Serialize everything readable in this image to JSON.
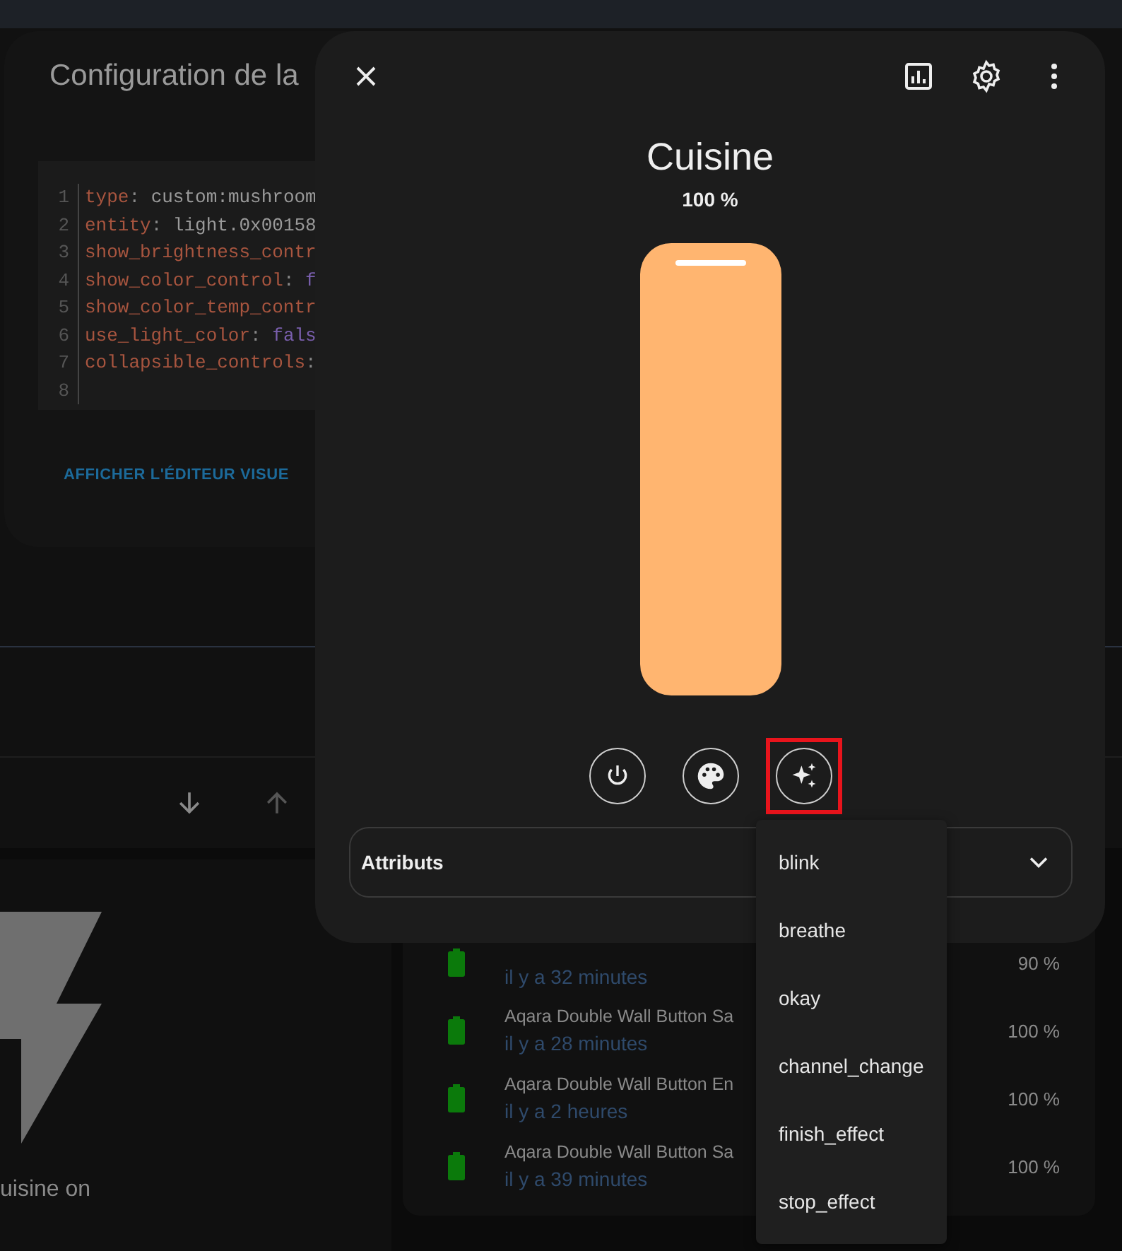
{
  "config_dialog": {
    "title": "Configuration de la",
    "code_lines": [
      {
        "number": "1",
        "segments": [
          {
            "text": "type",
            "kind": "key"
          },
          {
            "text": ":",
            "kind": "punct"
          },
          {
            "text": " custom:mushroom",
            "kind": "string"
          }
        ]
      },
      {
        "number": "2",
        "segments": [
          {
            "text": "entity",
            "kind": "key"
          },
          {
            "text": ":",
            "kind": "punct"
          },
          {
            "text": " light.0x00158",
            "kind": "string"
          }
        ]
      },
      {
        "number": "3",
        "segments": [
          {
            "text": "show_brightness_contr",
            "kind": "key"
          }
        ]
      },
      {
        "number": "4",
        "segments": [
          {
            "text": "show_color_control",
            "kind": "key"
          },
          {
            "text": ":",
            "kind": "punct"
          },
          {
            "text": " f",
            "kind": "boolean"
          }
        ]
      },
      {
        "number": "5",
        "segments": [
          {
            "text": "show_color_temp_contr",
            "kind": "key"
          }
        ]
      },
      {
        "number": "6",
        "segments": [
          {
            "text": "use_light_color",
            "kind": "key"
          },
          {
            "text": ":",
            "kind": "punct"
          },
          {
            "text": " fals",
            "kind": "boolean"
          }
        ]
      },
      {
        "number": "7",
        "segments": [
          {
            "text": "collapsible_controls",
            "kind": "key"
          },
          {
            "text": ":",
            "kind": "punct"
          }
        ]
      },
      {
        "number": "8"
      }
    ],
    "button": "AFFICHER L'ÉDITEUR VISUE"
  },
  "more_info": {
    "title": "Cuisine",
    "brightness": "100 %",
    "slider": {
      "level": 1
    },
    "controls": [
      {
        "kind": "power",
        "highlighted": false
      },
      {
        "kind": "color",
        "highlighted": false
      },
      {
        "kind": "effect",
        "highlighted": true
      }
    ],
    "attributes_label": "Attributs"
  },
  "effects_menu": [
    "blink",
    "breathe",
    "okay",
    "channel_change",
    "finish_effect",
    "stop_effect"
  ],
  "automation_card": {
    "label": "uisine on"
  },
  "battery_list": [
    {
      "time": "il y a 32 minutes",
      "percent": "90 %"
    },
    {
      "name": "Aqara Double Wall Button Sa",
      "time": "il y a 28 minutes",
      "percent": "100 %"
    },
    {
      "name": "Aqara Double Wall Button En",
      "time": "il y a 2 heures",
      "percent": "100 %"
    },
    {
      "name": "Aqara Double Wall Button Sa",
      "time": "il y a 39 minutes",
      "percent": "100 %"
    }
  ]
}
